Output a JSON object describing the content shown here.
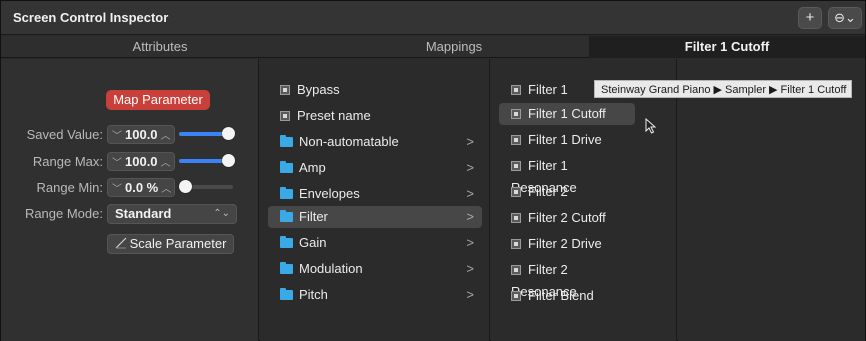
{
  "window": {
    "title": "Screen Control Inspector"
  },
  "toolbar": {
    "add_label": "+",
    "more_label": "⊖⌄"
  },
  "tabs": [
    {
      "label": "Attributes"
    },
    {
      "label": "Mappings"
    },
    {
      "label": "Filter 1 Cutoff"
    }
  ],
  "attributes": {
    "map_button": "Map Parameter",
    "saved_value": {
      "label": "Saved Value:",
      "value": "100.0",
      "level": 1.0
    },
    "range_max": {
      "label": "Range Max:",
      "value": "100.0",
      "level": 1.0
    },
    "range_min": {
      "label": "Range Min:",
      "value": "0.0 %",
      "level": 0.0
    },
    "range_mode": {
      "label": "Range Mode:",
      "value": "Standard"
    },
    "scale_button": "Scale Parameter"
  },
  "column1": [
    {
      "label": "Bypass",
      "type": "param"
    },
    {
      "label": "Preset name",
      "type": "param"
    },
    {
      "label": "Non-automatable",
      "type": "folder"
    },
    {
      "label": "Amp",
      "type": "folder"
    },
    {
      "label": "Envelopes",
      "type": "folder"
    },
    {
      "label": "Filter",
      "type": "folder",
      "selected": true
    },
    {
      "label": "Gain",
      "type": "folder"
    },
    {
      "label": "Modulation",
      "type": "folder"
    },
    {
      "label": "Pitch",
      "type": "folder"
    }
  ],
  "column2": [
    {
      "label": "Filter 1"
    },
    {
      "label": "Filter 1 Cutoff",
      "selected": true
    },
    {
      "label": "Filter 1 Drive"
    },
    {
      "label": "Filter 1 Resonance"
    },
    {
      "label": "Filter 2"
    },
    {
      "label": "Filter 2 Cutoff"
    },
    {
      "label": "Filter 2 Drive"
    },
    {
      "label": "Filter 2 Resonance"
    },
    {
      "label": "Filter Blend"
    }
  ],
  "tooltip": {
    "text": "Steinway Grand Piano ▶ Sampler ▶ Filter 1 Cutoff"
  },
  "colors": {
    "accent": "#3a82f7",
    "map_button": "#c9403a",
    "folder": "#3aa9e8"
  }
}
